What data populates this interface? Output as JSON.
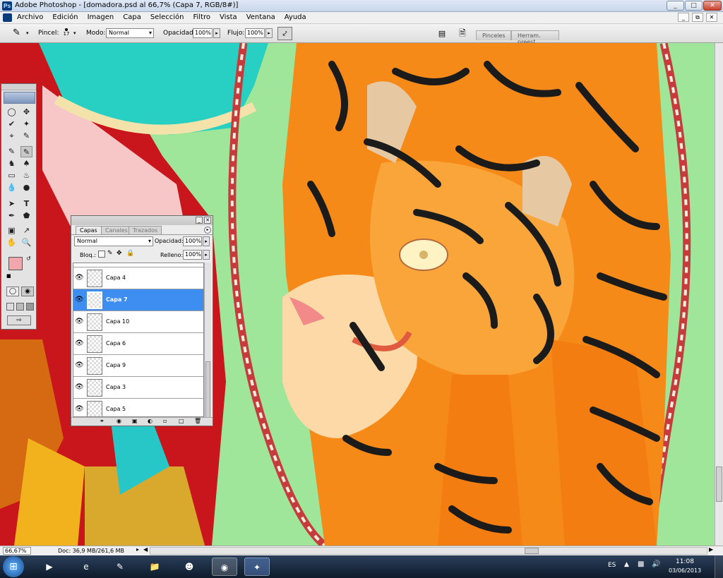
{
  "window": {
    "title": "Adobe Photoshop - [domadora.psd al 66,7% (Capa 7, RGB/8#)]",
    "min": "_",
    "max": "□",
    "close": "✕"
  },
  "menu": [
    "Archivo",
    "Edición",
    "Imagen",
    "Capa",
    "Selección",
    "Filtro",
    "Vista",
    "Ventana",
    "Ayuda"
  ],
  "doc_controls": {
    "min": "_",
    "restore": "⧉",
    "close": "✕"
  },
  "options": {
    "brush_label": "Pincel:",
    "brush_size": "17",
    "mode_label": "Modo:",
    "mode_value": "Normal",
    "opacity_label": "Opacidad:",
    "opacity_value": "100%",
    "flow_label": "Flujo:",
    "flow_value": "100%",
    "tabs": [
      "Pinceles",
      "Herram. preest."
    ]
  },
  "layers_panel": {
    "tabs": [
      "Capas",
      "Canales",
      "Trazados"
    ],
    "blend_mode": "Normal",
    "opacity_label": "Opacidad:",
    "opacity_value": "100%",
    "lock_label": "Bloq.:",
    "fill_label": "Relleno:",
    "fill_value": "100%",
    "layers": [
      {
        "name": "Capa 4",
        "selected": false
      },
      {
        "name": "Capa 7",
        "selected": true
      },
      {
        "name": "Capa 10",
        "selected": false
      },
      {
        "name": "Capa 6",
        "selected": false
      },
      {
        "name": "Capa 9",
        "selected": false
      },
      {
        "name": "Capa 3",
        "selected": false
      },
      {
        "name": "Capa 5",
        "selected": false
      }
    ],
    "footer_icons": [
      "link-icon",
      "fx-icon",
      "mask-icon",
      "adjustment-icon",
      "group-icon",
      "new-layer-icon",
      "trash-icon"
    ]
  },
  "status": {
    "zoom": "66,67%",
    "doc": "Doc: 36,9 MB/261,6 MB"
  },
  "taskbar": {
    "lang": "ES",
    "time": "11:08",
    "date": "03/06/2013"
  },
  "colors": {
    "foreground": "#f2a6ad",
    "background": "#c8500e",
    "selection": "#3d8ef0",
    "canvas_bg": "#9fe69a"
  }
}
